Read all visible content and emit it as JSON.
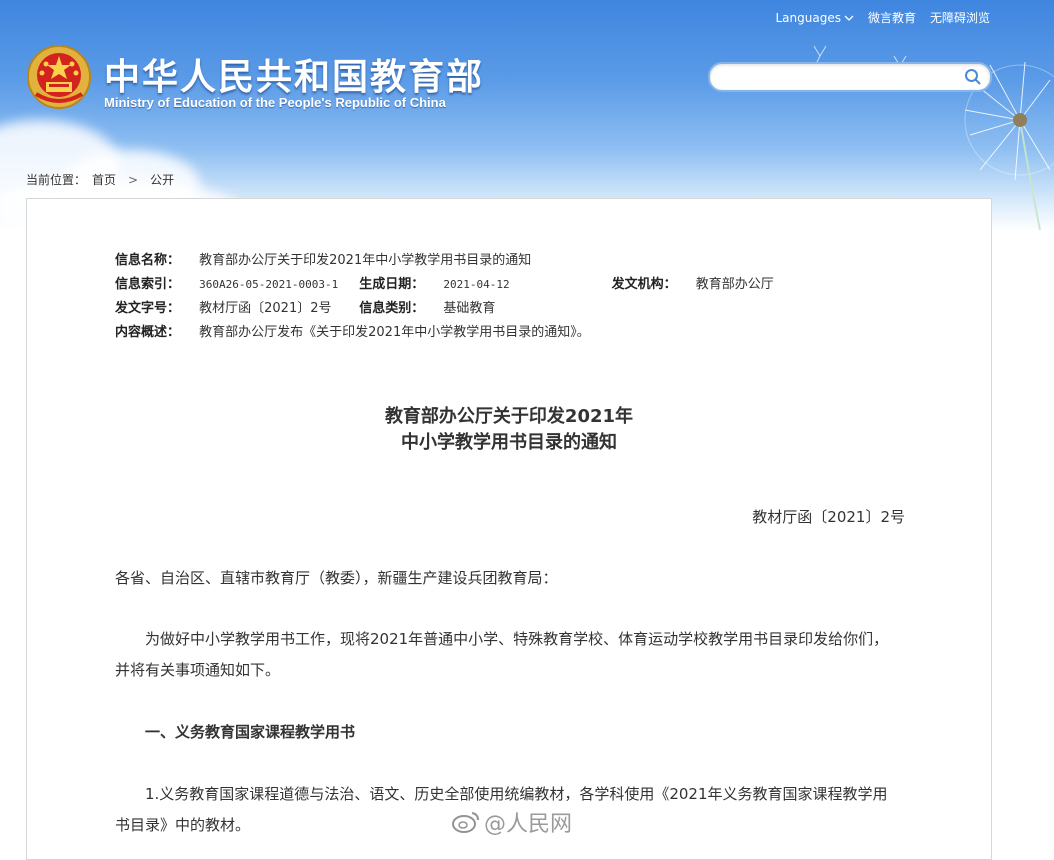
{
  "header": {
    "site_title": "中华人民共和国教育部",
    "site_subtitle": "Ministry of Education of the People's Republic of China",
    "links": [
      "Languages",
      "微言教育",
      "无障碍浏览"
    ]
  },
  "search": {
    "placeholder": ""
  },
  "breadcrumb": {
    "prefix": "当前位置：",
    "home": "首页",
    "separator": ">",
    "current": "公开"
  },
  "meta": {
    "name_label": "信息名称：",
    "name_value": "教育部办公厅关于印发2021年中小学教学用书目录的通知",
    "index_label": "信息索引：",
    "index_value": "360A26-05-2021-0003-1",
    "date_label": "生成日期：",
    "date_value": "2021-04-12",
    "org_label": "发文机构：",
    "org_value": "教育部办公厅",
    "docno_label": "发文字号：",
    "docno_value": "教材厅函〔2021〕2号",
    "category_label": "信息类别：",
    "category_value": "基础教育",
    "summary_label": "内容概述：",
    "summary_value": "教育部办公厅发布《关于印发2021年中小学教学用书目录的通知》。"
  },
  "doc": {
    "title_line1": "教育部办公厅关于印发2021年",
    "title_line2": "中小学教学用书目录的通知",
    "doc_number": "教材厅函〔2021〕2号",
    "salutation": "各省、自治区、直辖市教育厅（教委），新疆生产建设兵团教育局：",
    "para1": "为做好中小学教学用书工作，现将2021年普通中小学、特殊教育学校、体育运动学校教学用书目录印发给你们，并将有关事项通知如下。",
    "heading1": "一、义务教育国家课程教学用书",
    "para2": "1.义务教育国家课程道德与法治、语文、历史全部使用统编教材，各学科使用《2021年义务教育国家课程教学用书目录》中的教材。"
  },
  "watermark": {
    "text": "@人民网"
  },
  "colors": {
    "header_blue": "#3f86e0",
    "text": "#333333",
    "border": "#d6d6d6"
  }
}
